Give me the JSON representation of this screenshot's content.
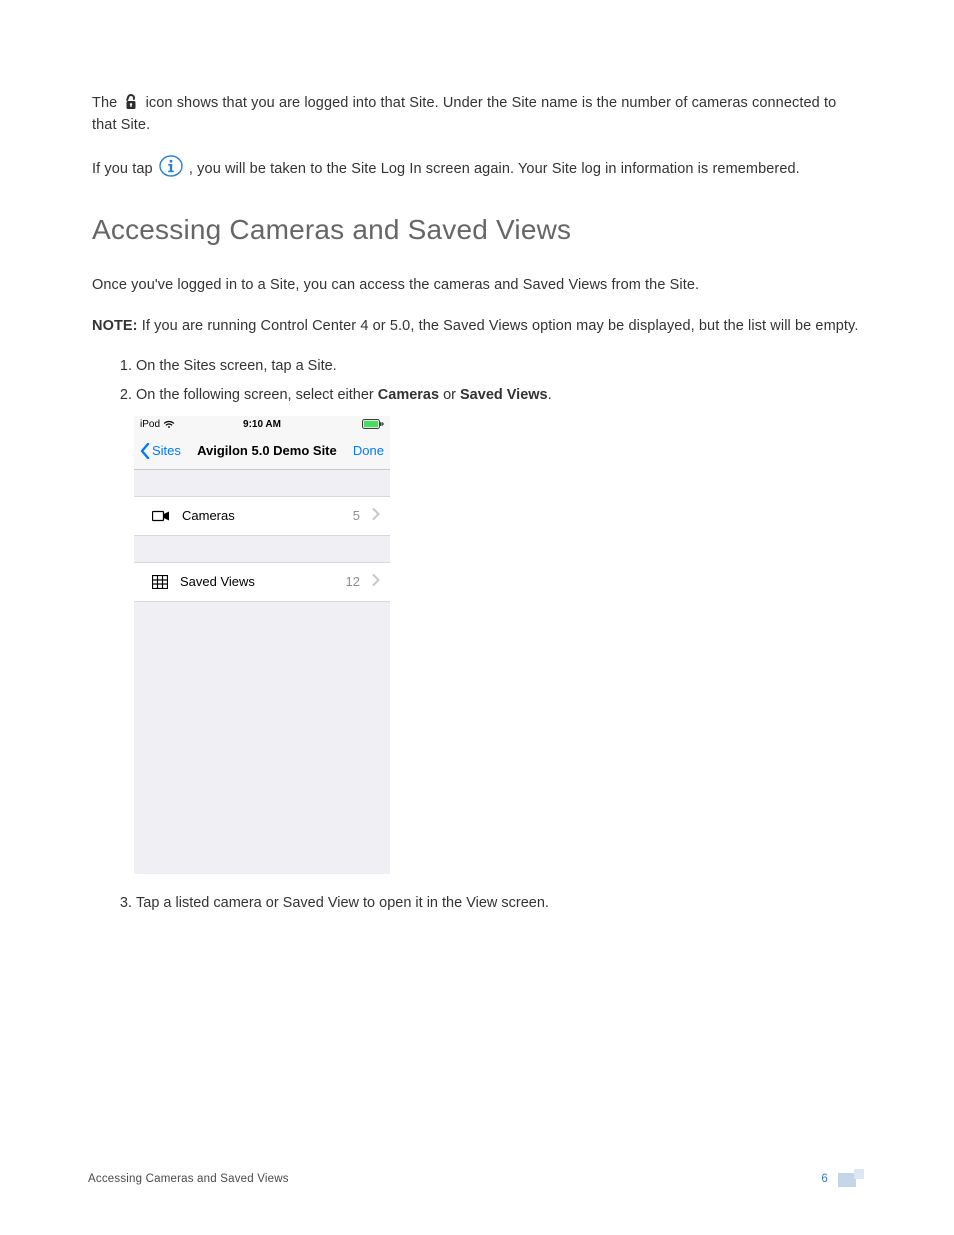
{
  "body": {
    "p1a": "The ",
    "p1b": " icon shows that you are logged into that Site. Under the Site name is the number of cameras connected to that Site.",
    "p2a": "If you tap ",
    "p2b": ", you will be taken to the Site Log In screen again. Your Site log in information is remembered.",
    "heading": "Accessing Cameras and Saved Views",
    "p3": "Once you've logged in to a Site, you can access the cameras and Saved Views from the Site.",
    "note_label": "NOTE:",
    "note_text": " If you are running Control Center 4 or 5.0, the Saved Views option may be displayed, but the list will be empty.",
    "li1": "On the Sites screen, tap a Site.",
    "li2a": "On the following screen, select either ",
    "li2_cameras": "Cameras",
    "li2_or": " or ",
    "li2_saved": "Saved Views",
    "li2b": ".",
    "li3": "Tap a listed camera or Saved View to open it in the View screen."
  },
  "phone": {
    "status": {
      "device": "iPod",
      "time": "9:10 AM"
    },
    "nav": {
      "back": "Sites",
      "title": "Avigilon 5.0 Demo Site",
      "done": "Done"
    },
    "rows": {
      "cameras": {
        "label": "Cameras",
        "count": "5"
      },
      "saved": {
        "label": "Saved Views",
        "count": "12"
      }
    }
  },
  "footer": {
    "section": "Accessing Cameras and Saved Views",
    "page": "6"
  }
}
